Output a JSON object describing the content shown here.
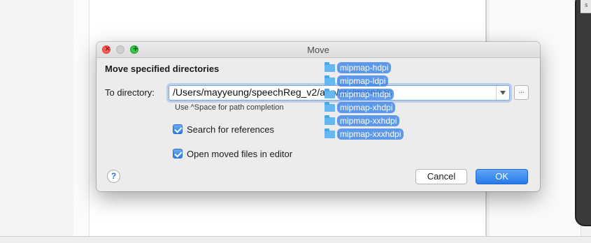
{
  "dialog": {
    "title": "Move",
    "heading": "Move specified directories",
    "to_directory_label": "To directory:",
    "to_directory_value": "/Users/mayyeung/speechReg_v2/app/src/main/res",
    "path_hint": "Use ^Space for path completion",
    "browse_label": "...",
    "search_references_label": "Search for references",
    "search_references_checked": true,
    "open_moved_files_label": "Open moved files in editor",
    "open_moved_files_checked": true,
    "help_label": "?",
    "cancel_label": "Cancel",
    "ok_label": "OK"
  },
  "dragged_items": [
    {
      "label": "mipmap-hdpi",
      "icon": "folder-icon"
    },
    {
      "label": "mipmap-ldpi",
      "icon": "folder-icon"
    },
    {
      "label": "mipmap-mdpi",
      "icon": "folder-icon"
    },
    {
      "label": "mipmap-xhdpi",
      "icon": "folder-icon"
    },
    {
      "label": "mipmap-xxhdpi",
      "icon": "folder-icon"
    },
    {
      "label": "mipmap-xxxhdpi",
      "icon": "folder-icon"
    }
  ],
  "background": {
    "device_label": "s"
  },
  "colors": {
    "accent": "#2679ea",
    "drag_highlight": "#3e85e6",
    "folder": "#64b7ef"
  }
}
